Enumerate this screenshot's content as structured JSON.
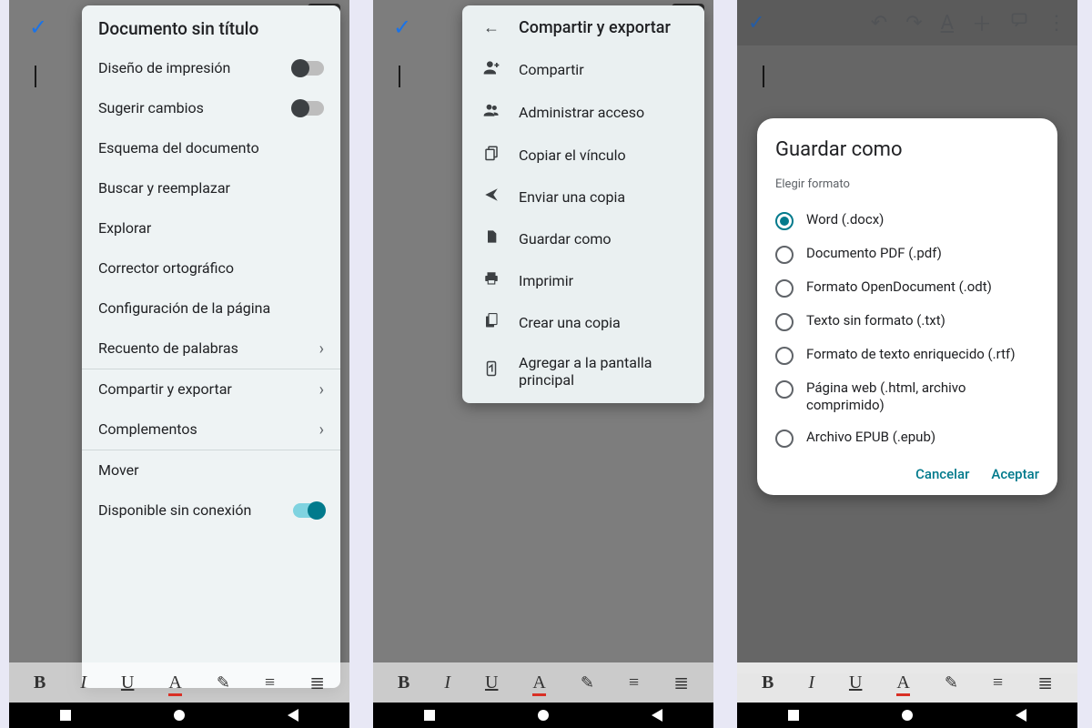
{
  "screens": {
    "menu1": {
      "title": "Documento sin título",
      "items": [
        {
          "label": "Diseño de impresión",
          "toggle": "off"
        },
        {
          "label": "Sugerir cambios",
          "toggle": "off"
        },
        {
          "label": "Esquema del documento"
        },
        {
          "label": "Buscar y reemplazar"
        },
        {
          "label": "Explorar"
        },
        {
          "label": "Corrector ortográfico"
        },
        {
          "label": "Configuración de la página"
        },
        {
          "label": "Recuento de palabras",
          "chevron": true
        },
        {
          "sep": true
        },
        {
          "label": "Compartir y exportar",
          "chevron": true
        },
        {
          "label": "Complementos",
          "chevron": true
        },
        {
          "sep": true
        },
        {
          "label": "Mover"
        },
        {
          "label": "Disponible sin conexión",
          "toggle": "on"
        }
      ]
    },
    "menu2": {
      "title": "Compartir y exportar",
      "items": [
        {
          "icon": "person-add",
          "label": "Compartir"
        },
        {
          "icon": "group",
          "label": "Administrar acceso"
        },
        {
          "icon": "copy-link",
          "label": "Copiar el vínculo"
        },
        {
          "icon": "send",
          "label": "Enviar una copia"
        },
        {
          "icon": "file",
          "label": "Guardar como"
        },
        {
          "icon": "print",
          "label": "Imprimir"
        },
        {
          "icon": "copy-doc",
          "label": "Crear una copia"
        },
        {
          "icon": "add-home",
          "label": "Agregar a la pantalla principal"
        }
      ]
    },
    "dialog": {
      "title": "Guardar como",
      "subtitle": "Elegir formato",
      "options": [
        {
          "label": "Word (.docx)",
          "selected": true
        },
        {
          "label": "Documento PDF (.pdf)"
        },
        {
          "label": "Formato OpenDocument (.odt)"
        },
        {
          "label": "Texto sin formato (.txt)"
        },
        {
          "label": "Formato de texto enriquecido (.rtf)"
        },
        {
          "label": "Página web (.html, archivo comprimido)"
        },
        {
          "label": "Archivo EPUB (.epub)"
        }
      ],
      "cancel": "Cancelar",
      "accept": "Aceptar"
    }
  },
  "topbar": {
    "icons": [
      "undo",
      "redo",
      "textformat",
      "plus",
      "comment",
      "more"
    ]
  },
  "bottombar": {
    "items": [
      "B",
      "I",
      "U",
      "A",
      "pencil",
      "align",
      "list"
    ]
  }
}
